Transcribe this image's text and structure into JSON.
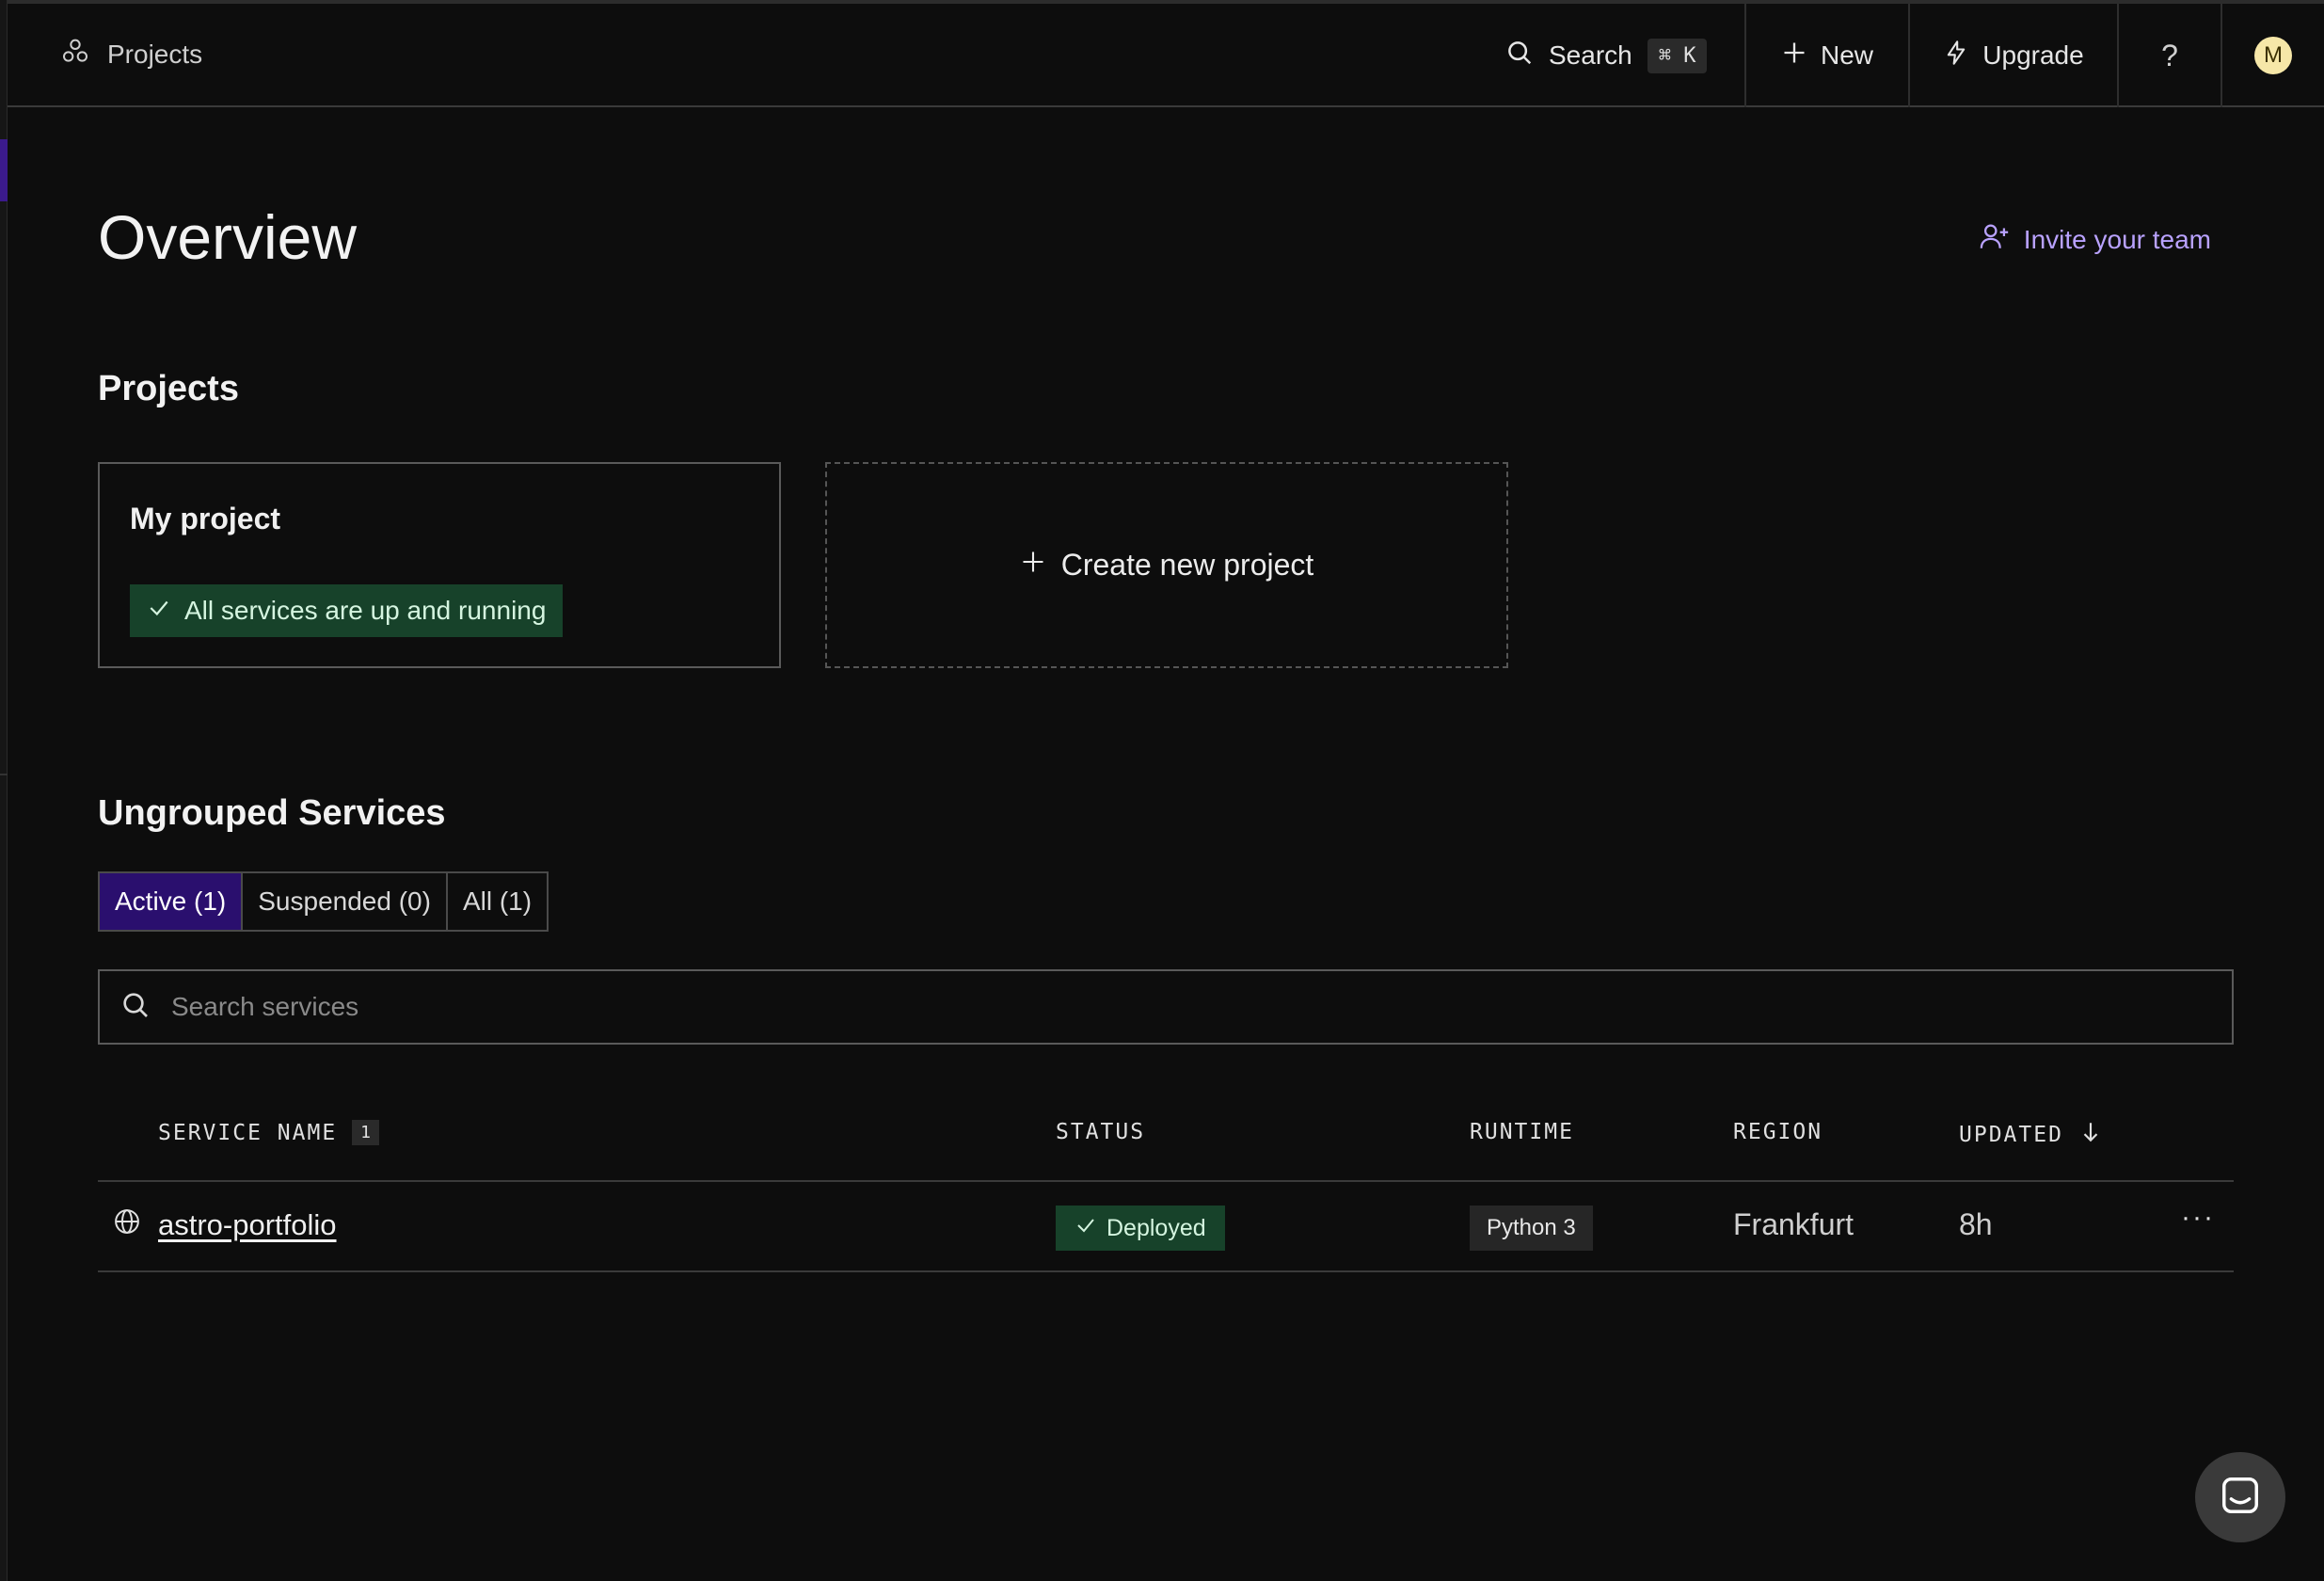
{
  "topbar": {
    "breadcrumb_label": "Projects",
    "search_label": "Search",
    "search_shortcut": "⌘ K",
    "new_label": "New",
    "upgrade_label": "Upgrade",
    "help_label": "?",
    "avatar_initial": "M"
  },
  "page": {
    "title": "Overview",
    "invite_label": "Invite your team"
  },
  "projects": {
    "heading": "Projects",
    "cards": [
      {
        "name": "My project",
        "status": "All services are up and running"
      }
    ],
    "create_label": "Create new project"
  },
  "services": {
    "heading": "Ungrouped Services",
    "tabs": [
      {
        "label": "Active (1)",
        "active": true
      },
      {
        "label": "Suspended (0)",
        "active": false
      },
      {
        "label": "All (1)",
        "active": false
      }
    ],
    "search_placeholder": "Search services",
    "columns": {
      "service_name": "SERVICE NAME",
      "service_count": "1",
      "status": "STATUS",
      "runtime": "RUNTIME",
      "region": "REGION",
      "updated": "UPDATED"
    },
    "rows": [
      {
        "name": "astro-portfolio",
        "status": "Deployed",
        "runtime": "Python 3",
        "region": "Frankfurt",
        "updated": "8h"
      }
    ]
  },
  "colors": {
    "accent": "#b9a2ff",
    "active_tab": "#2a0f6e",
    "success_bg": "#17422a",
    "avatar": "#f6e7a8"
  }
}
